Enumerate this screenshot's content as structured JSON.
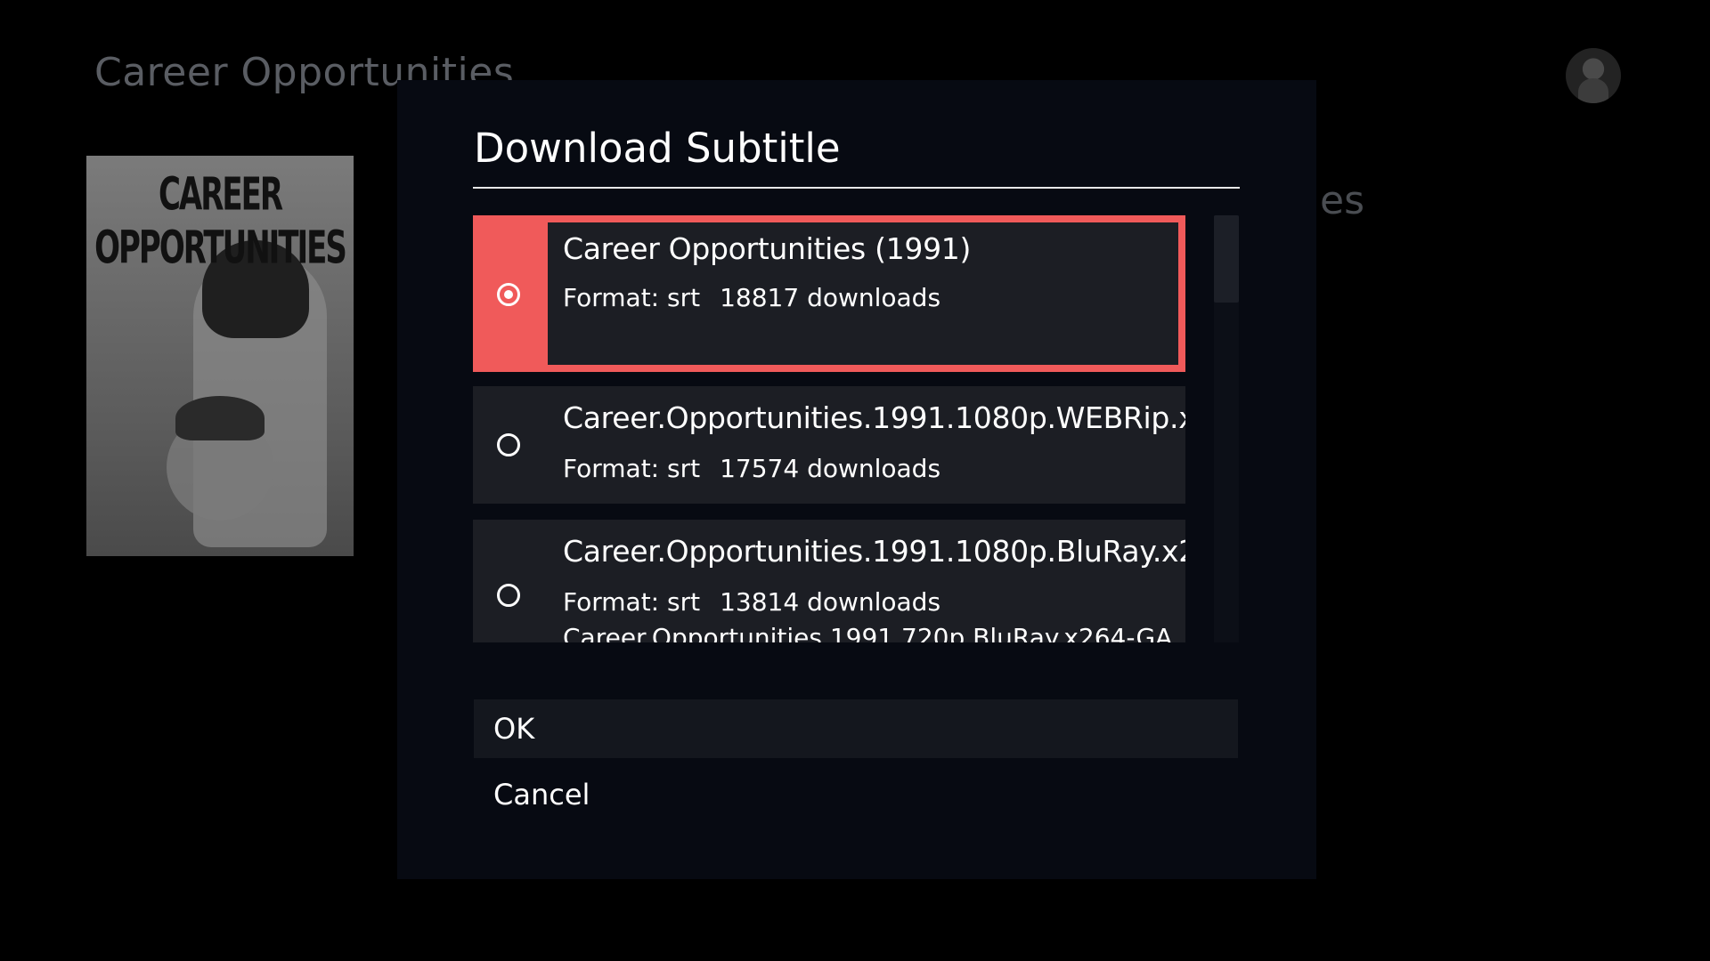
{
  "background": {
    "title": "Career Opportunities",
    "side_text": "es",
    "poster_title": "CAREER OPPORTUNITIES"
  },
  "dialog": {
    "title": "Download Subtitle",
    "items": [
      {
        "name": "Career Opportunities (1991)",
        "format": "Format: srt",
        "downloads": "18817 downloads",
        "selected": true
      },
      {
        "name": "Career.Opportunities.1991.1080p.WEBRip.x...",
        "format": "Format: srt",
        "downloads": "17574 downloads",
        "selected": false
      },
      {
        "name": "Career.Opportunities.1991.1080p.BluRay.x2...",
        "format": "Format: srt",
        "downloads": "13814 downloads",
        "selected": false,
        "extra": "Career.Opportunities.1991.720p.BluRay.x264-GA..."
      }
    ],
    "ok_label": "OK",
    "cancel_label": "Cancel"
  },
  "colors": {
    "accent": "#f05a5a",
    "dialog_bg": "#070a12",
    "item_bg": "#1c1e24"
  }
}
